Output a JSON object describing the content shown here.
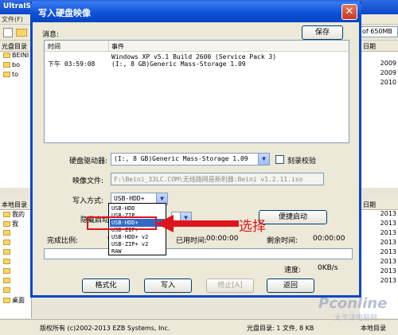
{
  "background": {
    "app_title": "UltraISO",
    "menu_file": "文件(F)",
    "size_box": "of 650MB",
    "left_top_header": "光盘目录",
    "left_top_items": [
      "BEINI",
      "bo",
      "to"
    ],
    "left_bottom_header": "本地目录",
    "left_bottom_items": [
      "我的",
      "我",
      "桌面"
    ],
    "right_col_header": "日期",
    "right_top_dates": [
      "2009",
      "2009",
      "2010"
    ],
    "right_bottom_dates": [
      "2013",
      "2013",
      "2013",
      "2013",
      "2013",
      "2013",
      "2013",
      "2013"
    ],
    "status_copyright": "版权所有 (c)2002-2013 EZB Systems, Inc.",
    "status_disc": "光盘目录: 1 文件, 8 KB",
    "status_local": "本地目录"
  },
  "dialog": {
    "title": "写入硬盘映像",
    "close_glyph": "✕",
    "messages_label": "消息:",
    "save_label": "保存",
    "col_time": "时间",
    "col_event": "事件",
    "log_time": "下午 03:59:08",
    "log_line1": "Windows XP v5.1 Build 2600 (Service Pack 3)",
    "log_line2": "(I:, 8 GB)Generic Mass-Storage    1.09",
    "drive_label": "硬盘驱动器:",
    "drive_value": "(I:, 8 GB)Generic Mass-Storage    1.09",
    "verify_label": "刻录校验",
    "image_label": "映像文件:",
    "image_value": "F:\\Beini_33LC.COM\\无线路网是新利器:Beini v1.2.11.iso",
    "write_mode_label": "写入方式:",
    "write_mode_value": "USB-HDD+",
    "hide_boot_label": "隐藏启动",
    "quick_boot_label": "便捷启动",
    "write_mode_options": [
      "USB-HDD",
      "USB-ZIP",
      "USB-HDD+",
      "USB-ZIP+",
      "USB-HDD+ v2",
      "USB-ZIP+ v2",
      "RAW"
    ],
    "selected_option": "USB-HDD+",
    "progress_label": "完成比例:",
    "progress_prefix": "0",
    "elapsed_label": "已用时间:",
    "elapsed_value": "00:00:00",
    "remaining_label": "剩余时间:",
    "remaining_value": "00:00:00",
    "speed_label": "速度:",
    "speed_value": "0KB/s",
    "btn_format": "格式化",
    "btn_write": "写入",
    "btn_stop": "终止[A]",
    "btn_back": "返回"
  },
  "annotation": {
    "text": "选择",
    "color": "#e0141b"
  },
  "watermark": {
    "brand": "Pconline",
    "sub": "太平洋电脑网"
  },
  "colors": {
    "titlebar": "#0a4fd6",
    "selection": "#316ac5",
    "annotation_red": "#e0141b"
  },
  "icons": {
    "close": "close-icon",
    "combo": "chevron-down-icon",
    "folder": "folder-icon",
    "arrow": "arrow-left-icon"
  }
}
